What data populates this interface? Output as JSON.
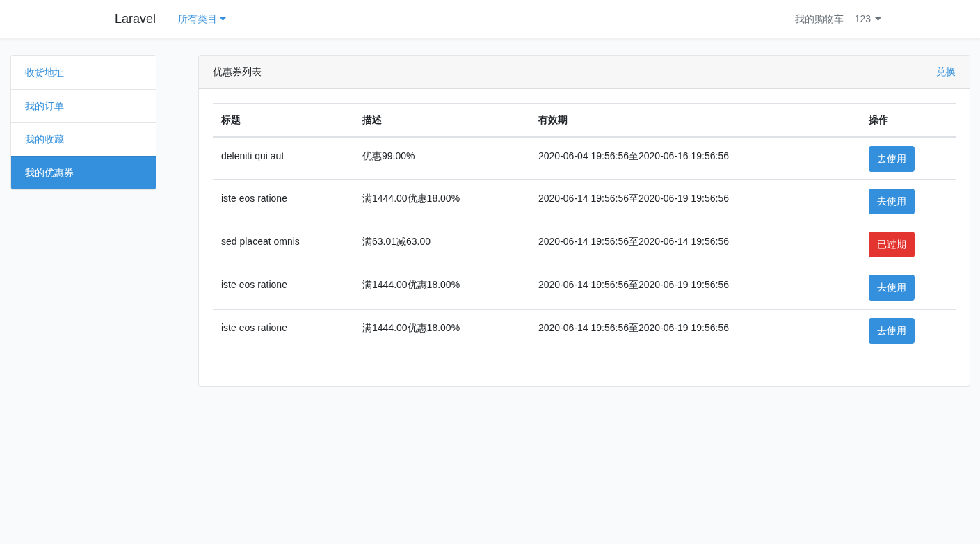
{
  "navbar": {
    "brand": "Laravel",
    "categories": "所有类目",
    "cart": "我的购物车",
    "user": "123"
  },
  "sidebar": {
    "items": [
      {
        "label": "收货地址",
        "selected": false
      },
      {
        "label": "我的订单",
        "selected": false
      },
      {
        "label": "我的收藏",
        "selected": false
      },
      {
        "label": "我的优惠券",
        "selected": true
      }
    ]
  },
  "card": {
    "title": "优惠券列表",
    "action": "兑换"
  },
  "table": {
    "columns": [
      "标题",
      "描述",
      "有效期",
      "操作"
    ],
    "rows": [
      {
        "title": "deleniti qui aut",
        "description": "优惠99.00%",
        "validity": "2020-06-04 19:56:56至2020-06-16 19:56:56",
        "button": {
          "label": "去使用",
          "kind": "use"
        }
      },
      {
        "title": "iste eos ratione",
        "description": "满1444.00优惠18.00%",
        "validity": "2020-06-14 19:56:56至2020-06-19 19:56:56",
        "button": {
          "label": "去使用",
          "kind": "use"
        }
      },
      {
        "title": "sed placeat omnis",
        "description": "满63.01减63.00",
        "validity": "2020-06-14 19:56:56至2020-06-14 19:56:56",
        "button": {
          "label": "已过期",
          "kind": "expired"
        }
      },
      {
        "title": "iste eos ratione",
        "description": "满1444.00优惠18.00%",
        "validity": "2020-06-14 19:56:56至2020-06-19 19:56:56",
        "button": {
          "label": "去使用",
          "kind": "use"
        }
      },
      {
        "title": "iste eos ratione",
        "description": "满1444.00优惠18.00%",
        "validity": "2020-06-14 19:56:56至2020-06-19 19:56:56",
        "button": {
          "label": "去使用",
          "kind": "use"
        }
      }
    ]
  }
}
